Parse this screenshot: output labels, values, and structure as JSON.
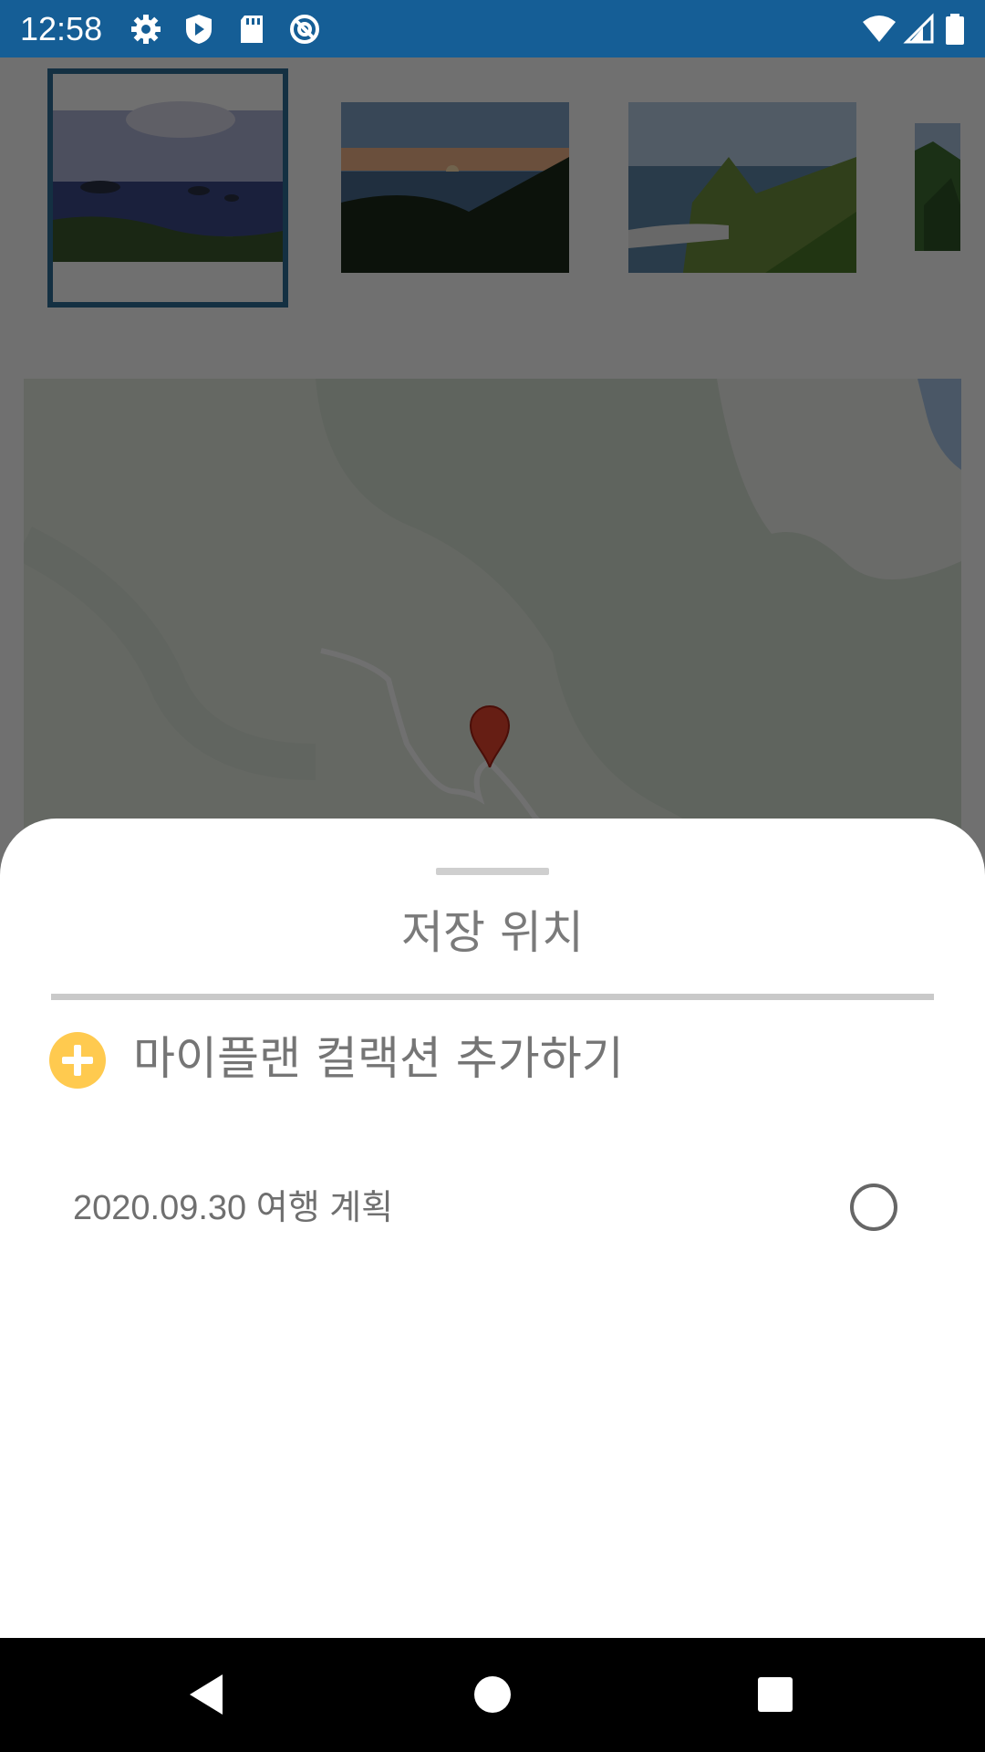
{
  "status_bar": {
    "time": "12:58",
    "background": "#155e96",
    "left_icons": [
      "gear-icon",
      "shield-play-icon",
      "sd-card-icon",
      "at-sign-icon"
    ],
    "right_icons": [
      "wifi-icon",
      "cellular-signal-icon",
      "battery-icon"
    ]
  },
  "thumbnails": {
    "count_visible": 4,
    "selected_index": 0,
    "items": [
      "island-sea-photo",
      "sunset-coast-photo",
      "harbor-cliff-photo",
      "green-cliff-photo"
    ]
  },
  "map": {
    "marker": "red-map-pin-icon"
  },
  "bottom_sheet": {
    "title": "저장 위치",
    "add_collection_label": "마이플랜 컬랙션 추가하기",
    "add_icon": "plus-circle-icon",
    "accent_color": "#ffca4f",
    "plans": [
      {
        "label": "2020.09.30 여행 계획",
        "selected": false
      }
    ]
  },
  "nav_bar": {
    "buttons": [
      "back-triangle-icon",
      "home-circle-icon",
      "recents-square-icon"
    ]
  }
}
